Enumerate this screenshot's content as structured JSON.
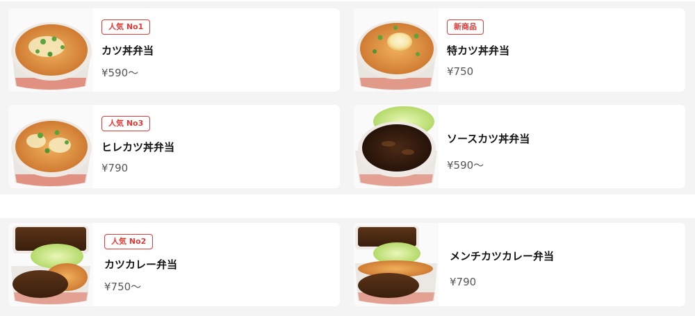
{
  "menu": {
    "section1": [
      {
        "badge": "人気 No1",
        "name": "カツ丼弁当",
        "price": "¥590〜",
        "image": "katsudon-photo"
      },
      {
        "badge": "新商品",
        "name": "特カツ丼弁当",
        "price": "¥750",
        "image": "special-katsudon-photo"
      },
      {
        "badge": "人気 No3",
        "name": "ヒレカツ丼弁当",
        "price": "¥790",
        "image": "hire-katsudon-photo"
      },
      {
        "badge": "",
        "name": "ソースカツ丼弁当",
        "price": "¥590〜",
        "image": "sauce-katsudon-photo"
      }
    ],
    "section2": [
      {
        "badge": "人気 No2",
        "name": "カツカレー弁当",
        "price": "¥750〜",
        "image": "katsu-curry-photo"
      },
      {
        "badge": "",
        "name": "メンチカツカレー弁当",
        "price": "¥790",
        "image": "menchi-katsu-curry-photo"
      }
    ]
  },
  "colors": {
    "badge": "#e53935",
    "section_bg": "#f4f4f4",
    "card_bg": "#ffffff",
    "price_text": "#555555"
  }
}
